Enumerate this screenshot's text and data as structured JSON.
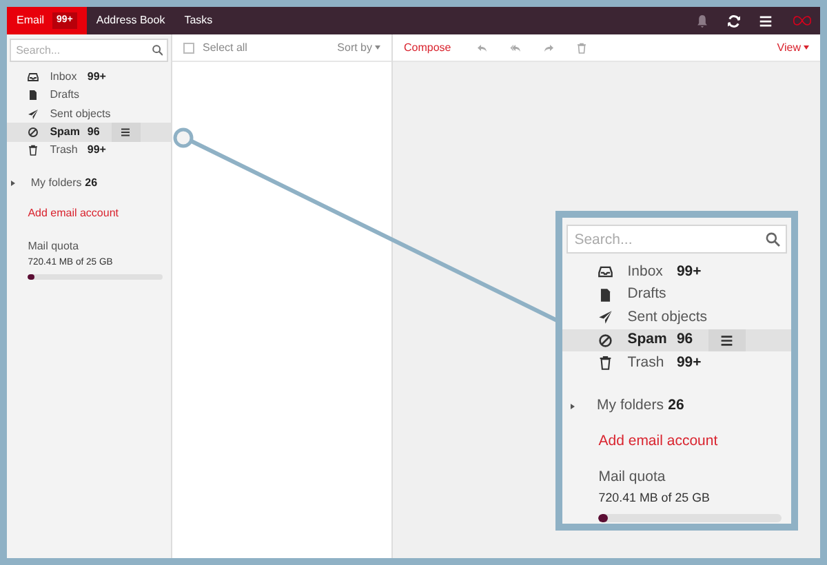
{
  "top_bar": {
    "tabs": [
      {
        "label": "Email",
        "badge": "99+",
        "selected": true
      },
      {
        "label": "Address Book",
        "selected": false
      },
      {
        "label": "Tasks",
        "selected": false
      }
    ]
  },
  "sidebar": {
    "search": {
      "placeholder": "Search..."
    },
    "folders": [
      {
        "kind": "inbox",
        "name": "Inbox",
        "count": "99+",
        "selected": false
      },
      {
        "kind": "drafts",
        "name": "Drafts",
        "selected": false
      },
      {
        "kind": "sent",
        "name": "Sent objects",
        "selected": false
      },
      {
        "kind": "spam",
        "name": "Spam",
        "count": "96",
        "selected": true
      },
      {
        "kind": "trash",
        "name": "Trash",
        "count": "99+",
        "selected": false
      }
    ],
    "my_folders": {
      "label": "My folders",
      "count": "26",
      "expanded": false
    },
    "add_account": "Add email account",
    "quota": {
      "label": "Mail quota",
      "reading": "720.41 MB of 25 GB",
      "level": 0.03
    }
  },
  "message_list": {
    "select_all": {
      "label": "Select all",
      "checked": false
    },
    "sort": "Sort by"
  },
  "reader_toolbar": {
    "compose": "Compose",
    "view": "View"
  },
  "callout": {
    "search": {
      "placeholder": "Search..."
    },
    "folders": [
      {
        "kind": "inbox",
        "name": "Inbox",
        "count": "99+",
        "selected": false
      },
      {
        "kind": "drafts",
        "name": "Drafts",
        "selected": false
      },
      {
        "kind": "sent",
        "name": "Sent objects",
        "selected": false
      },
      {
        "kind": "spam",
        "name": "Spam",
        "count": "96",
        "selected": true
      },
      {
        "kind": "trash",
        "name": "Trash",
        "count": "99+",
        "selected": false
      }
    ],
    "my_folders": {
      "label": "My folders",
      "count": "26",
      "expanded": false
    },
    "add_account": "Add email account",
    "quota": {
      "label": "Mail quota",
      "reading": "720.41 MB of 25 GB",
      "level": 0.03
    }
  }
}
